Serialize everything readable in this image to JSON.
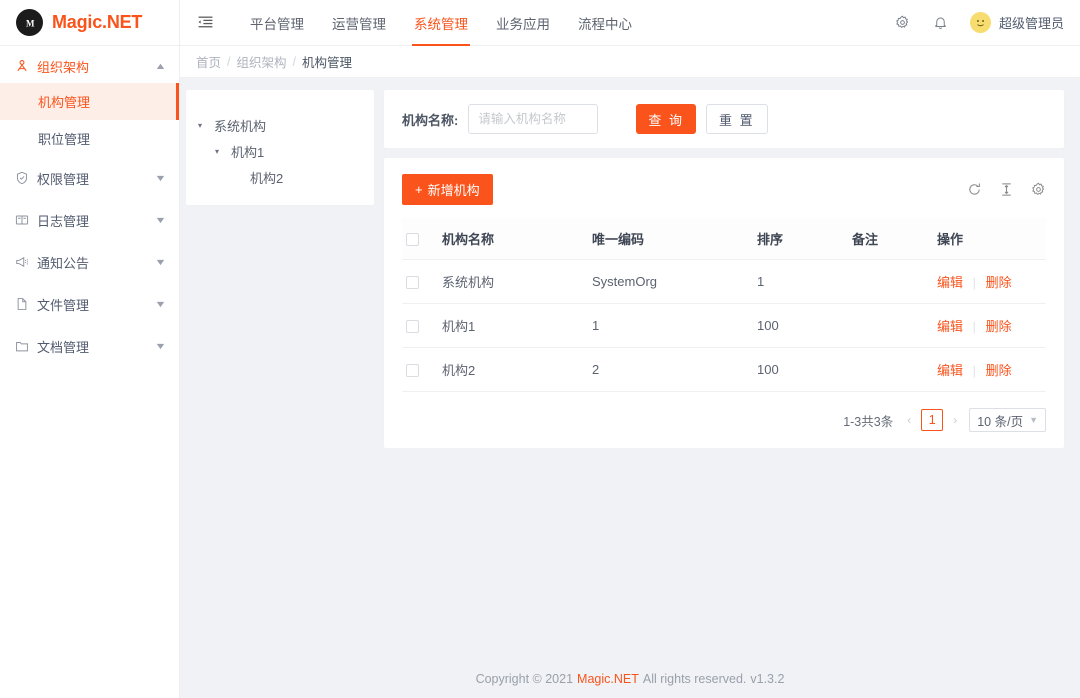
{
  "brand": {
    "name": "Magic.NET",
    "mark": "M",
    "accent": "#fa541c"
  },
  "sidebar": {
    "group": {
      "label": "组织架构",
      "icon": "org-structure-icon",
      "expanded": true
    },
    "sub_items": [
      {
        "label": "机构管理",
        "active": true
      },
      {
        "label": "职位管理",
        "active": false
      }
    ],
    "items": [
      {
        "label": "权限管理",
        "icon": "shield-check-icon"
      },
      {
        "label": "日志管理",
        "icon": "book-icon"
      },
      {
        "label": "通知公告",
        "icon": "megaphone-icon"
      },
      {
        "label": "文件管理",
        "icon": "file-icon"
      },
      {
        "label": "文档管理",
        "icon": "folder-icon"
      }
    ]
  },
  "topbar": {
    "fold_icon": "menu-fold-icon",
    "nav": [
      {
        "label": "平台管理",
        "active": false
      },
      {
        "label": "运营管理",
        "active": false
      },
      {
        "label": "系统管理",
        "active": true
      },
      {
        "label": "业务应用",
        "active": false
      },
      {
        "label": "流程中心",
        "active": false
      }
    ],
    "settings_icon": "gear-icon",
    "bell_icon": "bell-icon",
    "avatar_icon": "user-avatar",
    "user_name": "超级管理员"
  },
  "breadcrumb": {
    "items": [
      "首页",
      "组织架构",
      "机构管理"
    ],
    "separator": "/"
  },
  "tree": [
    {
      "label": "系统机构",
      "level": 1,
      "arrow": "▾"
    },
    {
      "label": "机构1",
      "level": 2,
      "arrow": "▾"
    },
    {
      "label": "机构2",
      "level": 3,
      "arrow": ""
    }
  ],
  "filter": {
    "label": "机构名称:",
    "input_value": "",
    "input_placeholder": "请输入机构名称",
    "search_label": "查 询",
    "reset_label": "重 置"
  },
  "table": {
    "add_label": "新增机构",
    "add_icon": "plus-icon",
    "tools": [
      {
        "icon": "reload-icon"
      },
      {
        "icon": "column-height-icon"
      },
      {
        "icon": "gear-icon"
      }
    ],
    "columns": [
      "机构名称",
      "唯一编码",
      "排序",
      "备注",
      "操作"
    ],
    "rows": [
      {
        "name": "系统机构",
        "code": "SystemOrg",
        "sort": "1",
        "remark": "",
        "edit": "编辑",
        "delete": "删除"
      },
      {
        "name": "机构1",
        "code": "1",
        "sort": "100",
        "remark": "",
        "edit": "编辑",
        "delete": "删除"
      },
      {
        "name": "机构2",
        "code": "2",
        "sort": "100",
        "remark": "",
        "edit": "编辑",
        "delete": "删除"
      }
    ]
  },
  "pagination": {
    "total_text": "1-3共3条",
    "prev": "‹",
    "next": "›",
    "current_page": "1",
    "page_size": "10 条/页"
  },
  "footer": {
    "prefix": "Copyright © 2021",
    "brand": "Magic.NET",
    "suffix": "All rights reserved.",
    "version": "v1.3.2"
  }
}
